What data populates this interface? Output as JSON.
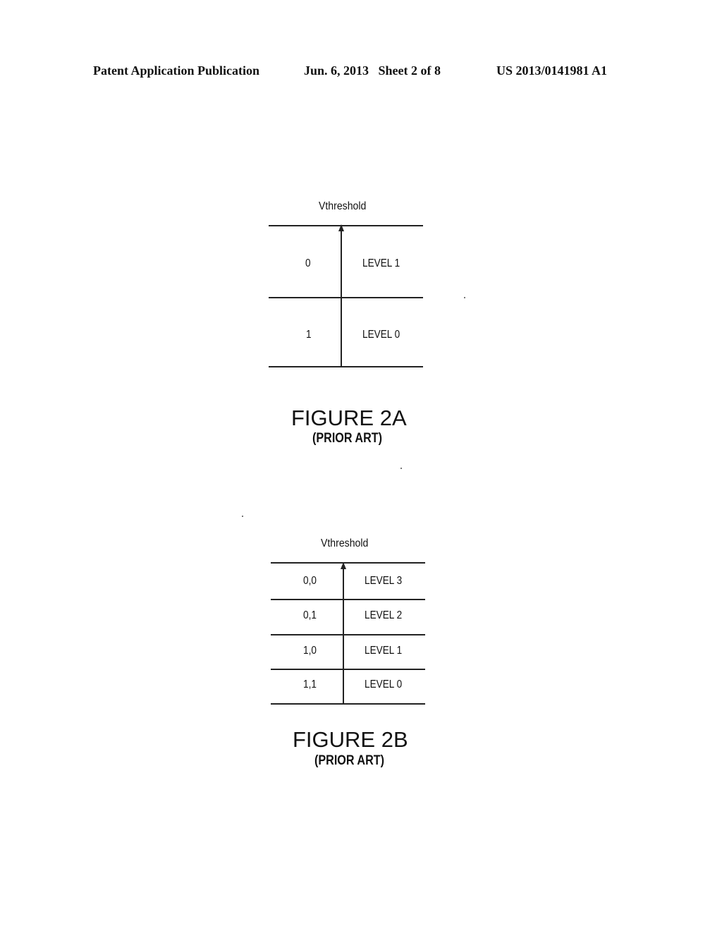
{
  "header": {
    "publication": "Patent Application Publication",
    "date_sheet": "Jun. 6, 2013   Sheet 2 of 8",
    "number": "US 2013/0141981 A1"
  },
  "figure_2a": {
    "axis_label": "Vthreshold",
    "rows": [
      {
        "bits": "0",
        "level": "LEVEL 1"
      },
      {
        "bits": "1",
        "level": "LEVEL 0"
      }
    ],
    "title": "FIGURE 2A",
    "subtitle": "(PRIOR ART)"
  },
  "figure_2b": {
    "axis_label": "Vthreshold",
    "rows": [
      {
        "bits": "0,0",
        "level": "LEVEL 3"
      },
      {
        "bits": "0,1",
        "level": "LEVEL 2"
      },
      {
        "bits": "1,0",
        "level": "LEVEL 1"
      },
      {
        "bits": "1,1",
        "level": "LEVEL 0"
      }
    ],
    "title": "FIGURE 2B",
    "subtitle": "(PRIOR ART)"
  }
}
